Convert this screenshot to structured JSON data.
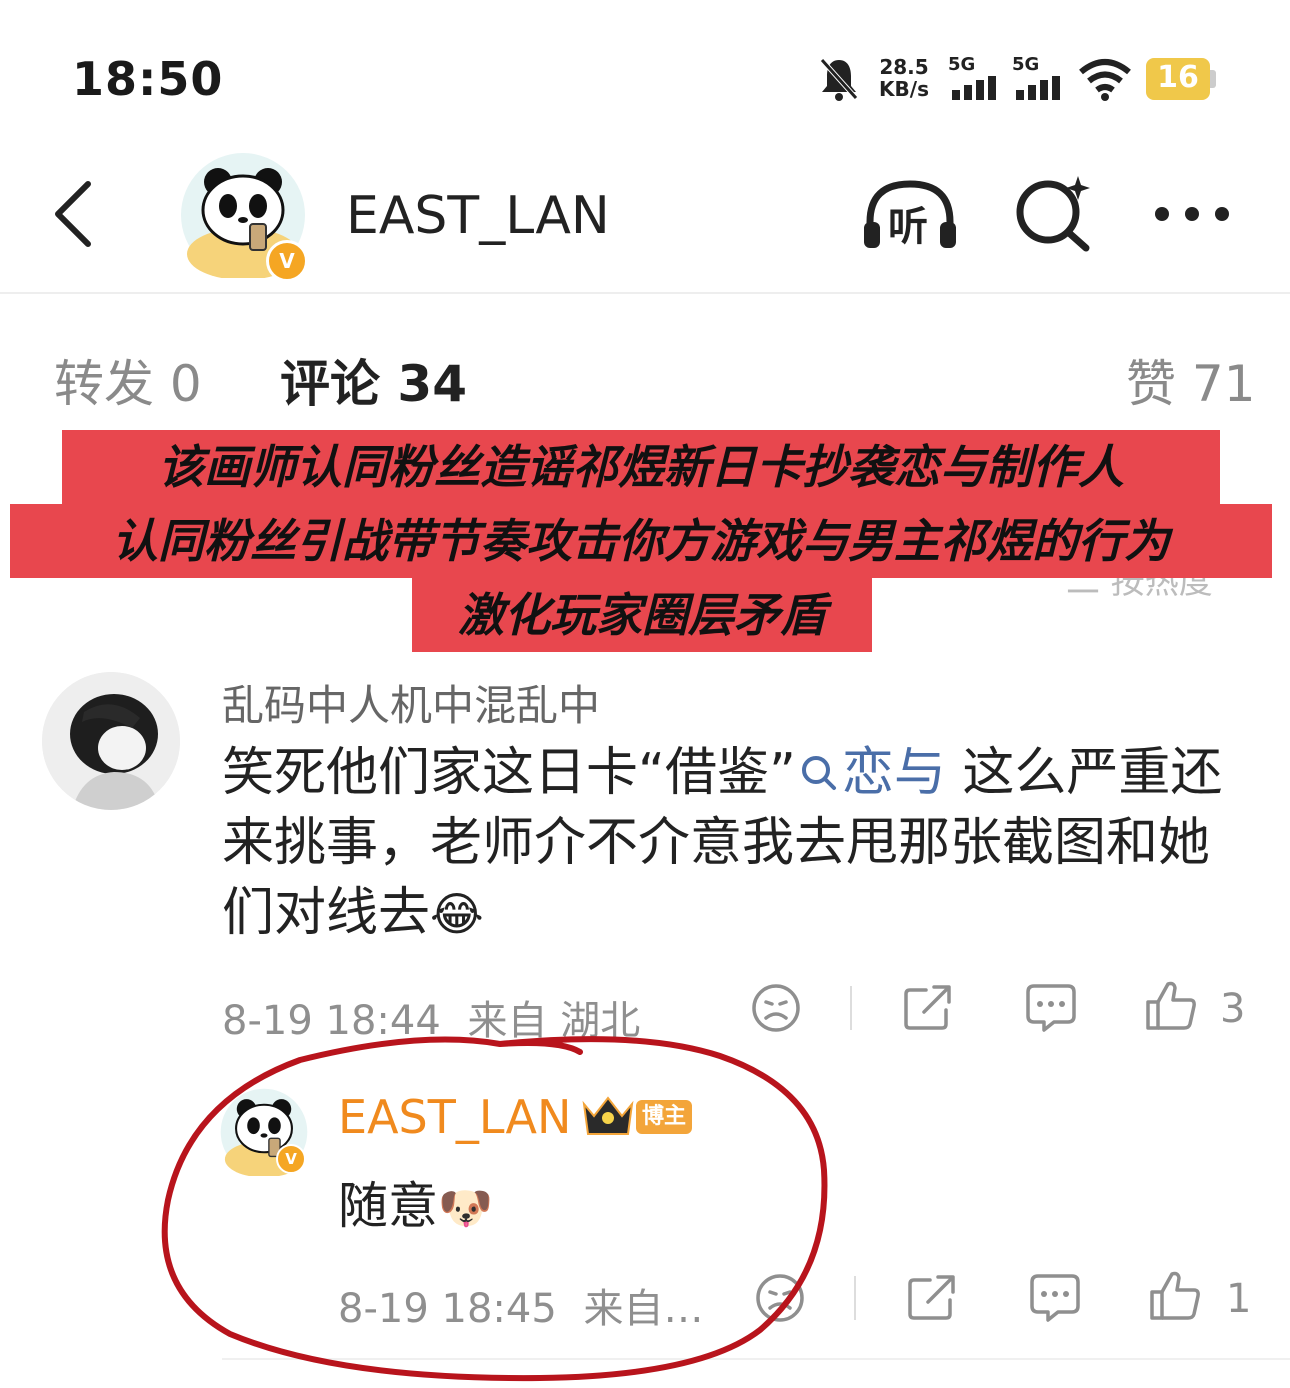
{
  "status_bar": {
    "time": "18:50",
    "net_speed_value": "28.5",
    "net_speed_unit": "KB/s",
    "signal_1": "5G",
    "signal_2": "5G",
    "battery": "16",
    "icons": [
      "bell-muted-icon",
      "signal-icon",
      "signal-icon",
      "wifi-icon",
      "battery-icon"
    ]
  },
  "header": {
    "back_icon": "chevron-left-icon",
    "title": "EAST_LAN",
    "listen_label": "听",
    "icons": [
      "headphones-icon",
      "search-sparkle-icon",
      "more-icon"
    ],
    "verified_mark": "V"
  },
  "tabs": [
    {
      "label": "转发 0"
    },
    {
      "label": "评论 34"
    },
    {
      "label": "赞 71"
    }
  ],
  "banner": {
    "lines": [
      "该画师认同粉丝造谣祁煜新日卡抄袭恋与制作人",
      "认同粉丝引战带节奏攻击你方游戏与男主祁煜的行为",
      "激化玩家圈层矛盾"
    ],
    "color": "#e8474e"
  },
  "sort": {
    "label": "二 按热度"
  },
  "comment": {
    "username": "乱码中人机中混乱中",
    "text_before": "笑死他们家这日卡“借鉴”",
    "topic": "恋与",
    "text_after": " 这么严重还来挑事，老师介不介意我去甩那张截图和她们对线去",
    "emoji": "😂",
    "time": "8-19 18:44",
    "location": "来自 湖北",
    "likes": "3"
  },
  "reply": {
    "username": "EAST_LAN",
    "tag": "博主",
    "text": "随意",
    "emoji": "🐶",
    "time": "8-19 18:45",
    "location": "来自…",
    "likes": "1"
  },
  "colors": {
    "accent_orange": "#f08a1e",
    "topic_blue": "#4a6ea8",
    "annotation_red": "#b8141c"
  }
}
